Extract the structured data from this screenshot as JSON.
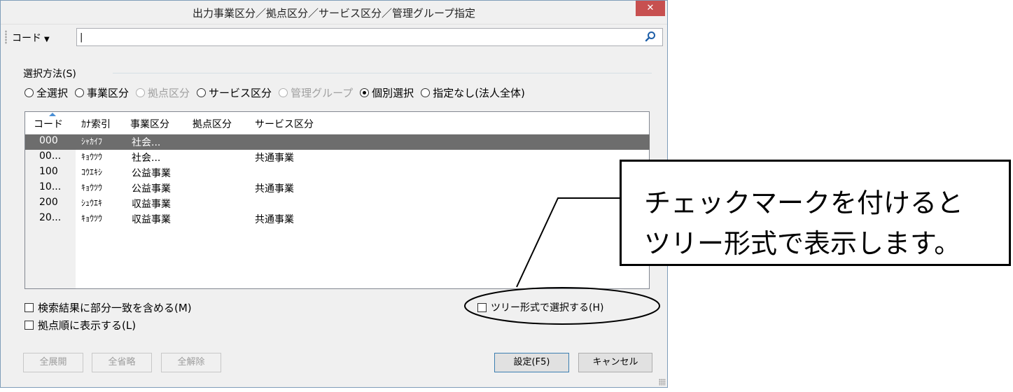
{
  "window": {
    "title": "出力事業区分／拠点区分／サービス区分／管理グループ指定",
    "close_glyph": "✕"
  },
  "search": {
    "field_label": "コード",
    "value": "|"
  },
  "selection_method": {
    "label": "選択方法(S)",
    "options": [
      {
        "label": "全選択",
        "state": "unchecked"
      },
      {
        "label": "事業区分",
        "state": "unchecked"
      },
      {
        "label": "拠点区分",
        "state": "disabled"
      },
      {
        "label": "サービス区分",
        "state": "unchecked"
      },
      {
        "label": "管理グループ",
        "state": "disabled"
      },
      {
        "label": "個別選択",
        "state": "checked"
      },
      {
        "label": "指定なし(法人全体)",
        "state": "unchecked"
      }
    ]
  },
  "list": {
    "columns": [
      "コード",
      "ｶﾅ索引",
      "事業区分",
      "拠点区分",
      "サービス区分"
    ],
    "rows": [
      {
        "code": "000",
        "kana": "ｼｬｶｲﾌ",
        "business": "社会...",
        "base": "",
        "service": ""
      },
      {
        "code": "00...",
        "kana": "ｷｮｳﾂｳ",
        "business": "社会...",
        "base": "",
        "service": "共通事業"
      },
      {
        "code": "100",
        "kana": "ｺｳｴｷｼ",
        "business": "公益事業",
        "base": "",
        "service": ""
      },
      {
        "code": "10...",
        "kana": "ｷｮｳﾂｳ",
        "business": "公益事業",
        "base": "",
        "service": "共通事業"
      },
      {
        "code": "200",
        "kana": "ｼｭｳｴｷ",
        "business": "収益事業",
        "base": "",
        "service": ""
      },
      {
        "code": "20...",
        "kana": "ｷｮｳﾂｳ",
        "business": "収益事業",
        "base": "",
        "service": "共通事業"
      }
    ],
    "selected_index": 0
  },
  "options": {
    "partial_match": "検索結果に部分一致を含める(M)",
    "base_order": "拠点順に表示する(L)",
    "tree_select": "ツリー形式で選択する(H)"
  },
  "buttons": {
    "expand_all": "全展開",
    "collapse_all": "全省略",
    "clear_all": "全解除",
    "ok": "設定(F5)",
    "cancel": "キャンセル"
  },
  "callout": {
    "line1": "チェックマークを付けると",
    "line2": "ツリー形式で表示します。"
  },
  "colors": {
    "selected_row": "#6d6d6d",
    "close_button": "#c75050",
    "search_icon": "#1e5fa8"
  }
}
